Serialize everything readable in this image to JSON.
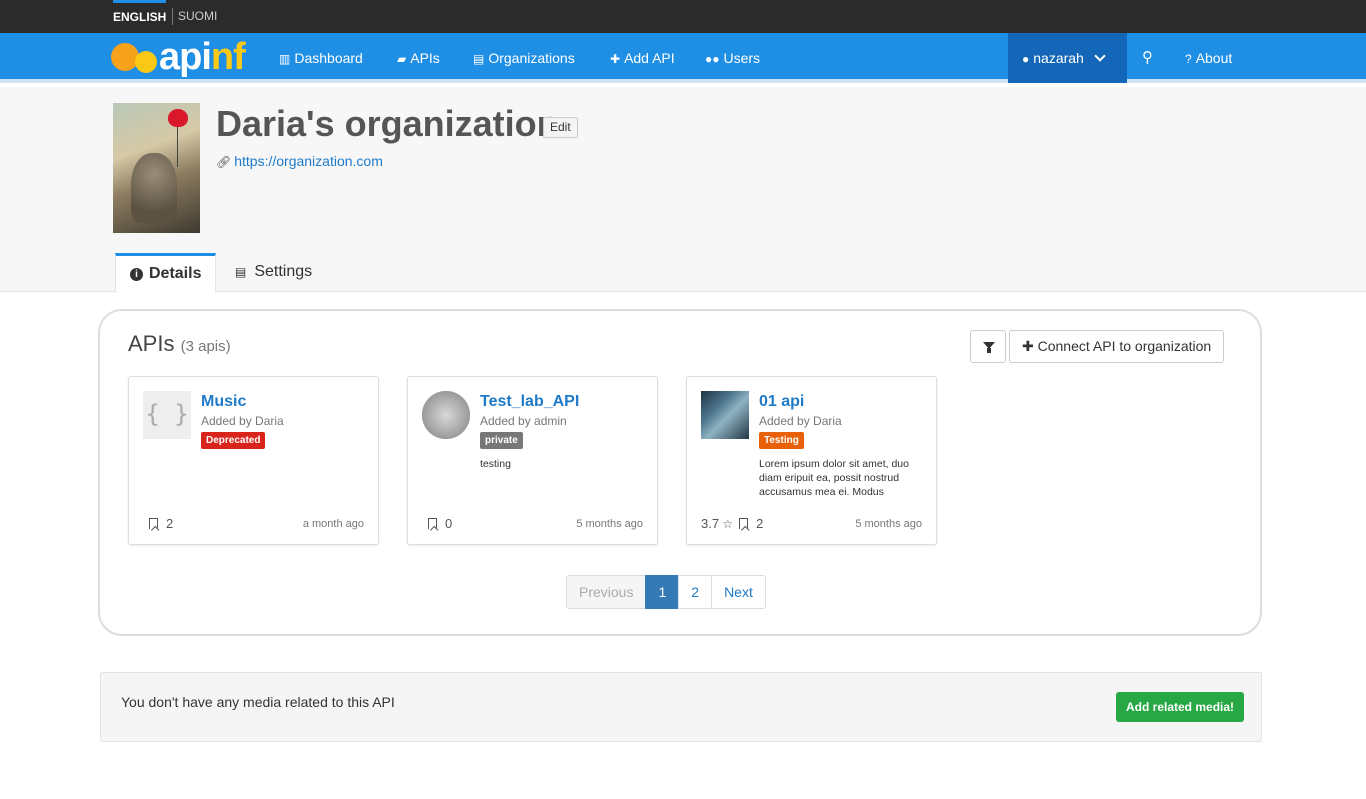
{
  "languages": [
    {
      "label": "ENGLISH",
      "active": true
    },
    {
      "label": "SUOMI",
      "active": false
    }
  ],
  "brand": {
    "logo_text_main": "api",
    "logo_text_accent": "nf"
  },
  "nav": {
    "dashboard": "Dashboard",
    "apis": "APIs",
    "organizations": "Organizations",
    "add_api": "Add API",
    "users": "Users",
    "user": "nazarah",
    "about": "About"
  },
  "org": {
    "title": "Daria's organization",
    "edit_label": "Edit",
    "url": "https://organization.com"
  },
  "tabs": {
    "details": "Details",
    "settings": "Settings"
  },
  "apis_panel": {
    "title": "APIs",
    "count": "(3 apis)",
    "connect_label": "Connect API to organization",
    "cards": [
      {
        "name": "Music",
        "added_by": "Added by Daria",
        "badge": "Deprecated",
        "badge_color": "#d9241c",
        "description": "",
        "rating": "",
        "bookmarks": "2",
        "time": "a month ago"
      },
      {
        "name": "Test_lab_API",
        "added_by": "Added by admin",
        "badge": "private",
        "badge_color": "#777777",
        "description": "testing",
        "rating": "",
        "bookmarks": "0",
        "time": "5 months ago"
      },
      {
        "name": "01 api",
        "added_by": "Added by Daria",
        "badge": "Testing",
        "badge_color": "#e8610a",
        "description": "Lorem ipsum dolor sit amet, duo diam eripuit ea, possit nostrud accusamus mea ei. Modus",
        "rating": "3.7",
        "bookmarks": "2",
        "time": "5 months ago"
      }
    ],
    "pagination": {
      "previous": "Previous",
      "pages": [
        "1",
        "2"
      ],
      "current": "1",
      "next": "Next"
    }
  },
  "media": {
    "message": "You don't have any media related to this API",
    "button": "Add related media!"
  },
  "colors": {
    "nav_bg": "#1f8ee5",
    "user_bg": "#1467b8",
    "link": "#1f7bc8",
    "success": "#28a745"
  }
}
